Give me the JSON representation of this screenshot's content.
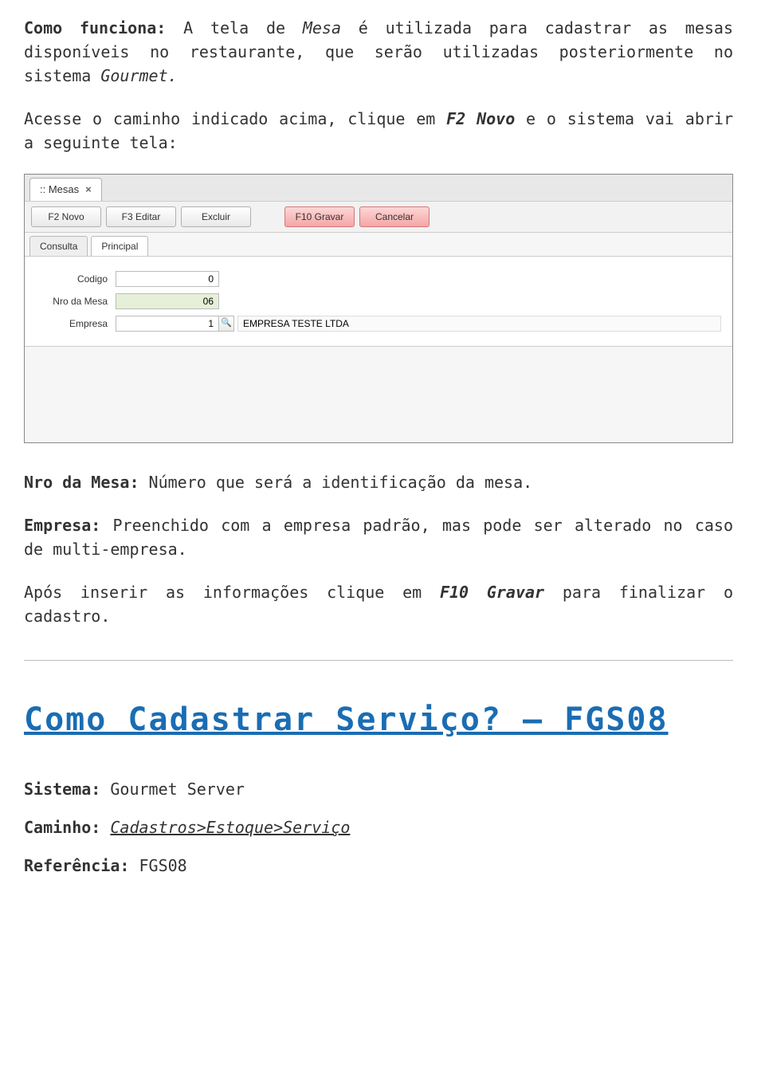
{
  "doc": {
    "intro": {
      "label": "Como funciona:",
      "body_before": " A tela de ",
      "body_em": "Mesa",
      "body_after": " é utilizada para cadastrar as mesas disponíveis no restaurante, que serão utilizadas posteriormente no sistema ",
      "body_em2": "Gourmet.",
      "tail": ""
    },
    "access": {
      "before": "Acesse o caminho indicado acima, clique em ",
      "em": "F2 Novo",
      "after": " e o sistema vai abrir a seguinte tela:"
    },
    "nro": {
      "label": "Nro da Mesa:",
      "text": " Número que será a identificação da mesa."
    },
    "empresa": {
      "label": "Empresa:",
      "text": " Preenchido com a empresa padrão, mas pode ser alterado no caso de multi-empresa."
    },
    "afterInsert": {
      "before": "Após inserir as informações clique em ",
      "em": "F10 Gravar",
      "after": " para finalizar o cadastro."
    },
    "title2": "Como Cadastrar Serviço? – FGS08",
    "sistema": {
      "label": "Sistema:",
      "value": " Gourmet Server"
    },
    "caminho": {
      "label": "Caminho:",
      "value": "Cadastros>Estoque>Serviço"
    },
    "ref": {
      "label": "Referência:",
      "value": " FGS08"
    }
  },
  "ui": {
    "tab_title": ":: Mesas",
    "close": "×",
    "toolbar": {
      "novo": "F2 Novo",
      "editar": "F3 Editar",
      "excluir": "Excluir",
      "gravar": "F10 Gravar",
      "cancelar": "Cancelar"
    },
    "subtabs": {
      "consulta": "Consulta",
      "principal": "Principal"
    },
    "form": {
      "codigo_label": "Codigo",
      "codigo_value": "0",
      "nro_label": "Nro da Mesa",
      "nro_value": "06",
      "empresa_label": "Empresa",
      "empresa_value": "1",
      "lookup_glyph": "🔍",
      "empresa_name": "EMPRESA TESTE LTDA"
    }
  }
}
